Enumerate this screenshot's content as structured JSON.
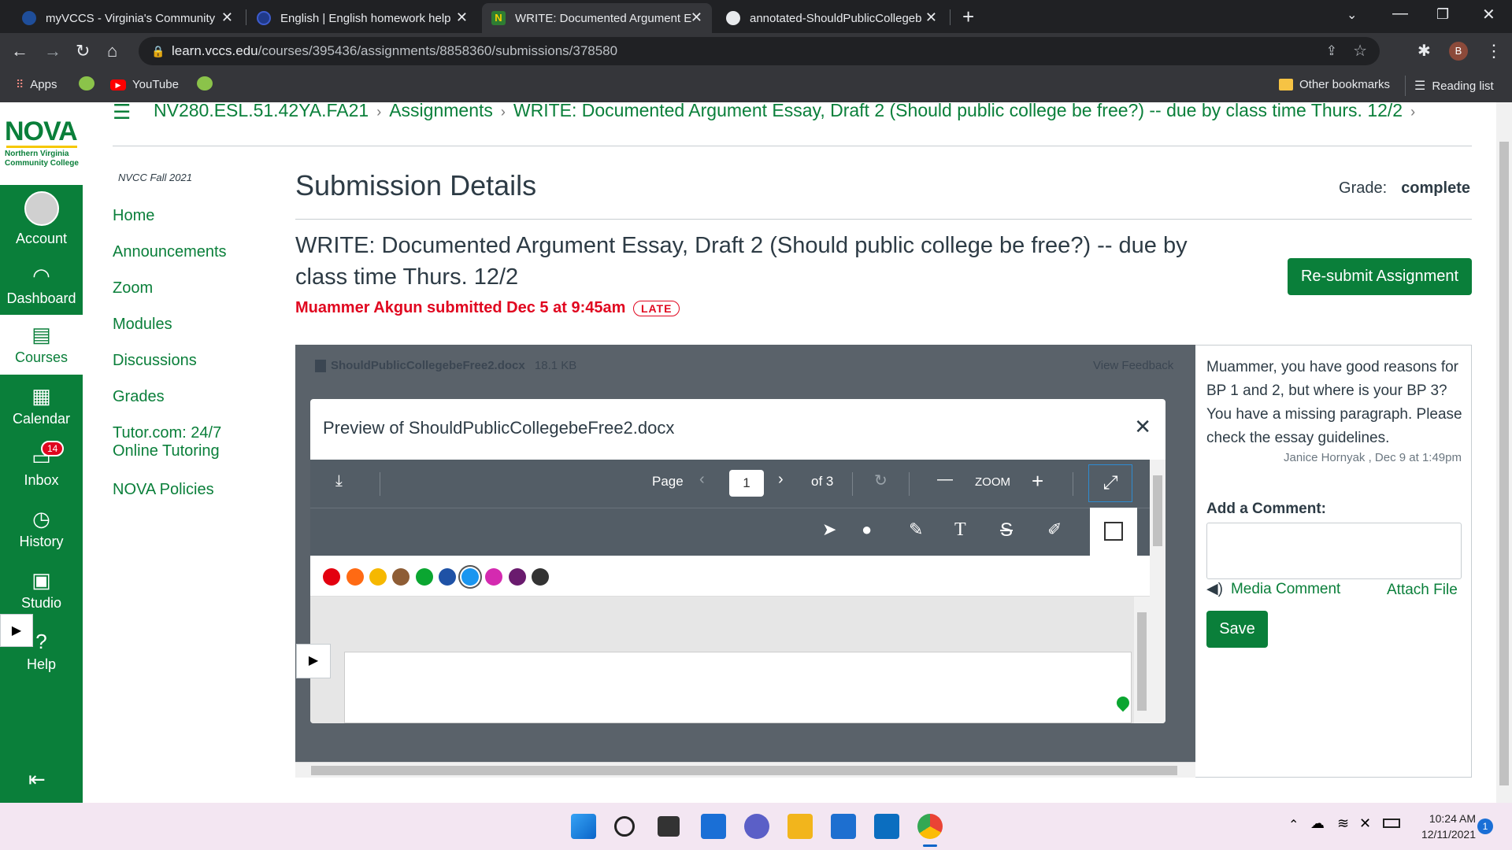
{
  "browser": {
    "tabs": [
      {
        "title": "myVCCS - Virginia's Community",
        "active": false
      },
      {
        "title": "English | English homework help",
        "active": false
      },
      {
        "title": "WRITE: Documented Argument E",
        "active": true
      },
      {
        "title": "annotated-ShouldPublicCollegeb",
        "active": false
      }
    ],
    "url_host": "learn.vccs.edu",
    "url_path": "/courses/395436/assignments/8858360/submissions/378580",
    "profile_initial": "B",
    "bookmarks": {
      "apps": "Apps",
      "youtube": "YouTube",
      "other": "Other bookmarks",
      "reading_list": "Reading list"
    }
  },
  "brand": {
    "logo": "NOVA",
    "logo_sub1": "Northern Virginia",
    "logo_sub2": "Community College",
    "green": "#0a7f3a"
  },
  "global_nav": {
    "account": "Account",
    "dashboard": "Dashboard",
    "courses": "Courses",
    "calendar": "Calendar",
    "inbox": "Inbox",
    "inbox_badge": "14",
    "history": "History",
    "studio": "Studio",
    "help": "Help"
  },
  "breadcrumb": {
    "course": "NV280.ESL.51.42YA.FA21",
    "assignments": "Assignments",
    "assignment": "WRITE: Documented Argument Essay, Draft 2 (Should public college be free?) -- due by class time Thurs. 12/2"
  },
  "course_nav": {
    "term": "NVCC Fall 2021",
    "items": [
      "Home",
      "Announcements",
      "Zoom",
      "Modules",
      "Discussions",
      "Grades",
      "Tutor.com: 24/7",
      "Online Tutoring",
      "NOVA Policies"
    ]
  },
  "submission": {
    "heading": "Submission Details",
    "grade_label": "Grade:",
    "grade_value": "complete",
    "assignment_title": "WRITE: Documented Argument Essay, Draft 2 (Should public college be free?) -- due by class time Thurs. 12/2",
    "submitted_text": "Muammer Akgun submitted Dec 5 at 9:45am",
    "late_badge": "LATE",
    "resubmit_label": "Re-submit Assignment"
  },
  "file": {
    "name": "ShouldPublicCollegebeFree2.docx",
    "size": "18.1 KB",
    "view_feedback": "View Feedback"
  },
  "preview": {
    "title": "Preview of ShouldPublicCollegebeFree2.docx",
    "page_label": "Page",
    "page_value": "1",
    "page_total": "of 3",
    "zoom_label": "ZOOM",
    "colors": [
      "#e3000f",
      "#ff6a13",
      "#f6b800",
      "#8e5d35",
      "#0ba631",
      "#1f52a6",
      "#1a96f0",
      "#d42ab0",
      "#6a1b6e",
      "#333333"
    ]
  },
  "comments": {
    "comment_text": "Muammer,  you have good reasons for BP 1 and 2, but where is your BP 3?  You have a missing paragraph.  Please check the essay guidelines.",
    "comment_meta": "Janice Hornyak , Dec 9 at 1:49pm",
    "add_label": "Add a Comment:",
    "media_comment": "Media Comment",
    "attach_file": "Attach File",
    "save_label": "Save"
  },
  "taskbar": {
    "time": "10:24 AM",
    "date": "12/11/2021",
    "notification_count": "1"
  }
}
